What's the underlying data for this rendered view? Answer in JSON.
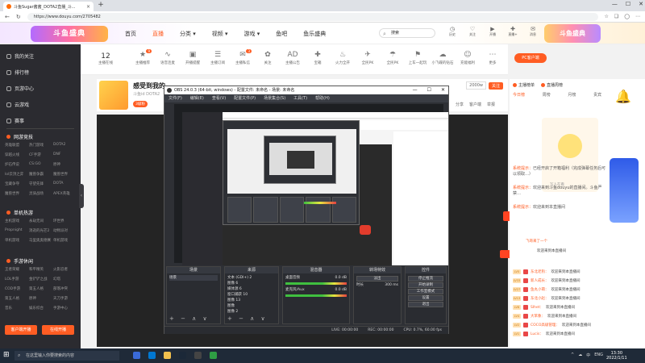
{
  "browser": {
    "tab_title": "斗鱼Sugar酱酱_DOTA2直播_斗...",
    "tab_close": "×",
    "new_tab": "+",
    "url": "https://www.douyu.com/2705482",
    "win_min": "—",
    "win_max": "☐",
    "win_close": "✕"
  },
  "header": {
    "logo_text": "斗鱼盛典",
    "nav": [
      "首页",
      "直播",
      "分类 ▾",
      "视频 ▾",
      "游戏 ▾",
      "鱼吧",
      "鱼乐盛典"
    ],
    "active_nav": "直播",
    "search_placeholder": "搜索",
    "top_icons": [
      "历史",
      "关注",
      "开播",
      "直播+",
      "消息",
      "下载",
      "创作中心"
    ],
    "banner_text": "斗鱼盛典"
  },
  "sidebar": {
    "items": [
      "我的关注",
      "排行榜",
      "页游中心",
      "云游戏",
      "赛事"
    ],
    "section1": "网游竞技",
    "section1_tags": [
      "英雄联盟",
      "热门游戏",
      "DOTA2",
      "穿越火线",
      "CF手游",
      "DNF",
      "炉石传说",
      "CS:GO",
      "原神",
      "lol云顶之弈",
      "魔兽争霸",
      "魔兽世界",
      "宝藏争夺",
      "守望先锋",
      "DOTA",
      "魔兽世界",
      "灵骑战场",
      "APEX英雄"
    ],
    "section2": "单机热游",
    "section2_tags": [
      "主机游戏",
      "永劫无间",
      "环世界",
      "Propnight",
      "消逝的光芒2",
      "动物派对",
      "单机游戏",
      "马里奥奥德赛",
      "单机游戏"
    ],
    "section3": "手游休闲",
    "section3_tags": [
      "王者荣耀",
      "和平精英",
      "火影忍者",
      "LOL手游",
      "金铲铲之战",
      "幻塔",
      "COD手游",
      "第五人格",
      "部落冲突",
      "第五人格",
      "原神",
      "天刀手游",
      "音乐",
      "娱乐综合",
      "手游中心"
    ],
    "btn_left": "客户端开播",
    "btn_right": "在线开播",
    "collapse": "‹"
  },
  "category_bar": {
    "count_value": "12",
    "count_label": "主播在线",
    "items": [
      {
        "icon": "★",
        "label": "主播推荐",
        "badge": "9"
      },
      {
        "icon": "∿",
        "label": "语音连麦",
        "badge": ""
      },
      {
        "icon": "▣",
        "label": "开播提醒",
        "badge": ""
      },
      {
        "icon": "☰",
        "label": "主播订阅",
        "badge": ""
      },
      {
        "icon": "✉",
        "label": "主播私信",
        "badge": "3"
      },
      {
        "icon": "✿",
        "label": "关注",
        "badge": ""
      },
      {
        "icon": "AD",
        "label": "主播公告",
        "badge": ""
      },
      {
        "icon": "✚",
        "label": "宝箱",
        "badge": ""
      },
      {
        "icon": "♨",
        "label": "火力全开",
        "badge": ""
      },
      {
        "icon": "✈",
        "label": "全民PK",
        "badge": ""
      },
      {
        "icon": "☂",
        "label": "全民PK",
        "badge": ""
      },
      {
        "icon": "⚑",
        "label": "上车一起玩",
        "badge": ""
      },
      {
        "icon": "☁",
        "label": "小飞碟的钻石",
        "badge": ""
      },
      {
        "icon": "☺",
        "label": "充能福利",
        "badge": ""
      },
      {
        "icon": "⋯",
        "label": "更多",
        "badge": ""
      }
    ],
    "pc_button": "PC客户端"
  },
  "streamer": {
    "title": "感受到我的",
    "subtitle": "斗鱼id  DOTA2",
    "badge": "3级粉",
    "follow_count": "2000w",
    "follow_btn": "关注",
    "links": [
      "分享",
      "客户端",
      "举报"
    ]
  },
  "obs": {
    "title": "OBS 24.0.3 (64-bit, windows) - 配置文件: 未命名 - 场景: 未命名",
    "menu": [
      "文件(F)",
      "编辑(E)",
      "查看(V)",
      "配置文件(P)",
      "场景集合(S)",
      "工具(T)",
      "帮助(H)"
    ],
    "docks": {
      "scenes_title": "场景",
      "scenes": [
        "场景"
      ],
      "sources_title": "来源",
      "sources": [
        "文本 (GDI+) 2",
        "图像 6",
        "媒体源 6",
        "窗口捕获 10",
        "图像 13",
        "图像",
        "图像 2"
      ],
      "mixer_title": "混音器",
      "mixer": [
        {
          "name": "桌面音频",
          "db": "0.0 dB"
        },
        {
          "name": "麦克风/Aux",
          "db": "0.0 dB"
        }
      ],
      "transitions_title": "转场特效",
      "transition_type": "淡出",
      "duration_label": "时长",
      "duration_value": "300 ms",
      "controls_title": "控件",
      "controls": [
        "停止推流",
        "开始录制",
        "工作室模式",
        "设置",
        "退出"
      ]
    },
    "status": [
      "LIVE: 00:00:00",
      "REC: 00:00:00",
      "CPU: 0.7%, 60.00 fps"
    ],
    "ctrl_icons": "+  −  ∧  ∨"
  },
  "right_panel": {
    "tabs": [
      "主播榜单",
      "直播周榜"
    ],
    "subtabs": [
      "今日榜",
      "周榜",
      "月榜",
      "贵宾"
    ],
    "art_caption": "写人在看",
    "chat_messages": [
      {
        "tag": "系统提示：",
        "text": "已经开启了开箱福利（完成弹幕任务后可以领取…）"
      },
      {
        "tag": "系统提示：",
        "text": "欢迎来到斗鱼douyu的直播间。斗鱼严禁…"
      },
      {
        "tag": "系统提示：",
        "text": "欢迎来到本直播间"
      }
    ],
    "list": [
      {
        "lv": "LV5",
        "name": "东北老狗：",
        "text": "欢迎来到本直播间"
      },
      {
        "lv": "LV33",
        "name": "新人成长：",
        "text": "欢迎来到本直播间"
      },
      {
        "lv": "LV27",
        "name": "鱼丸小萌：",
        "text": "欢迎来到本直播间"
      },
      {
        "lv": "LV13",
        "name": "东北小赵：",
        "text": "欢迎来到本直播间"
      },
      {
        "lv": "LV8",
        "name": "Slhet：",
        "text": "欢迎来到本直播间"
      },
      {
        "lv": "LV4",
        "name": "大笨象：",
        "text": "欢迎来到本直播间"
      },
      {
        "lv": "LV2",
        "name": "COCO高级管理：",
        "text": "欢迎来到本直播间"
      },
      {
        "lv": "LV1",
        "name": "Lucis：",
        "text": "欢迎来到本直播间"
      }
    ],
    "float_top": "飞哥来了一个",
    "float_mid": "欢迎来到本直播间"
  },
  "taskbar": {
    "search_placeholder": "在这里输入你要搜索的内容",
    "tray": [
      "^",
      "☁",
      "中",
      "ENG"
    ],
    "time": "13:30",
    "date": "2022/1/11"
  }
}
